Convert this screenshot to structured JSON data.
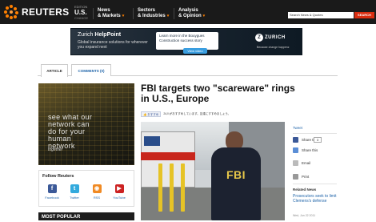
{
  "header": {
    "logo_text": "REUTERS",
    "edition_label": "EDITION",
    "edition_value": "U.S.",
    "edition_sub": "CHANGE",
    "nav": [
      {
        "line1": "News",
        "line2": "& Markets"
      },
      {
        "line1": "Sectors",
        "line2": "& Industries"
      },
      {
        "line1": "Analysis",
        "line2": "& Opinion"
      }
    ],
    "search_placeholder": "Search News & Quotes",
    "search_button": "SEARCH"
  },
  "ad": {
    "title_brand": "Zurich",
    "title_rest": "HelpPoint",
    "subtitle": "Global insurance solutions for wherever you expand next",
    "box_text": "Learn more in the Bouygues Construction success story",
    "button": "View video",
    "brand": "ZURICH",
    "tagline": "Because change happenz"
  },
  "tabs": [
    {
      "label": "ARTICLE"
    },
    {
      "label": "COMMENTS (0)"
    }
  ],
  "left": {
    "promo_text": "see what our network can do for your human network",
    "promo_brand": "together",
    "follow_title": "Follow Reuters",
    "social": [
      {
        "label": "Facebook",
        "glyph": "f",
        "color": "#3b5998"
      },
      {
        "label": "Twitter",
        "glyph": "t",
        "color": "#33aadd"
      },
      {
        "label": "RSS",
        "glyph": "◉",
        "color": "#f08a24"
      },
      {
        "label": "YouTube",
        "glyph": "▶",
        "color": "#cc2222"
      }
    ],
    "most_popular": "MOST POPULAR"
  },
  "article": {
    "headline": "FBI targets two \"scareware\" rings in U.S., Europe",
    "like_button": "おすすめ",
    "share_count_text": "24人がおすすめしています。友達にすすめましょう。"
  },
  "right": {
    "tweet": "Tweet",
    "share_this": "Share this",
    "share_count": "3",
    "email": "Email",
    "print": "Print",
    "related_title": "Related News",
    "related_link": "Prosecutors seek to limit Clemens's defense",
    "related_date": "Wed, Jun 22 2011"
  }
}
